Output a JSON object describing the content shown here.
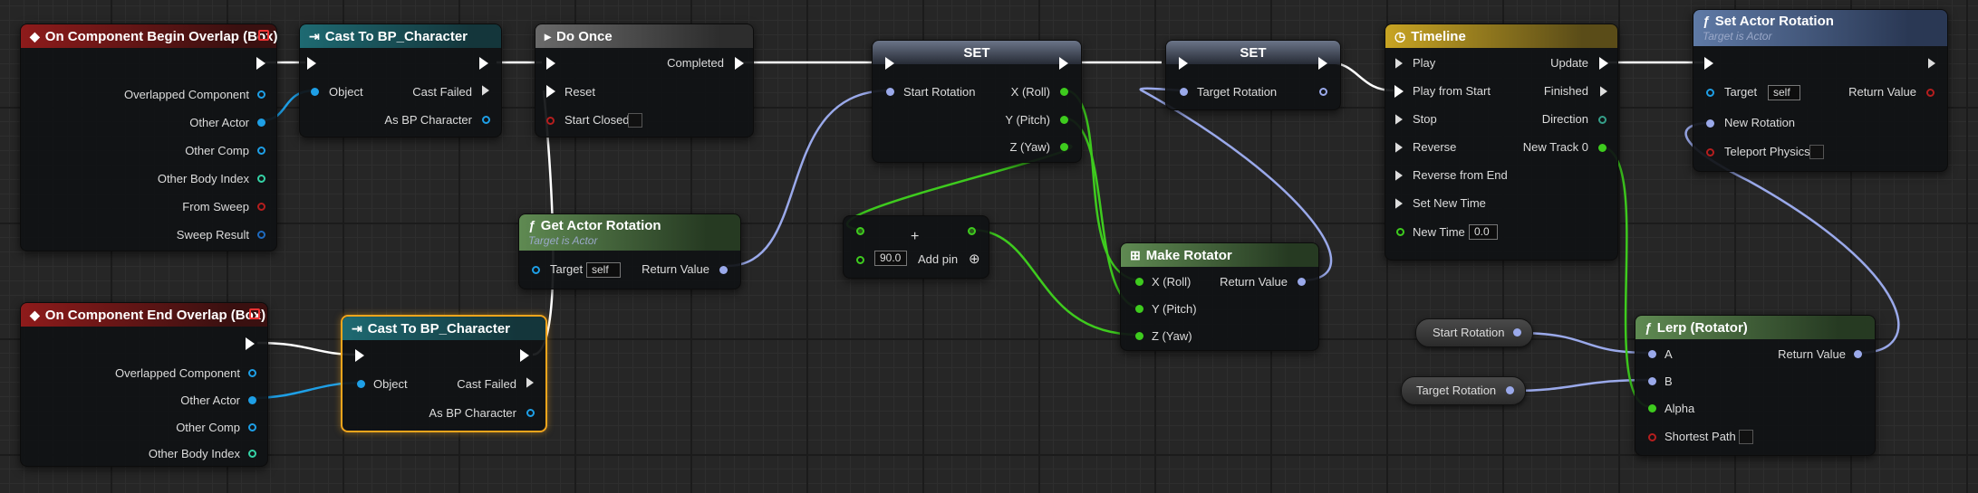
{
  "colors": {
    "exec": "#ffffff",
    "object": "#1e9fe6",
    "struct_rotator": "#9aa9ea",
    "float": "#3ecb1e",
    "bool": "#b51e1e",
    "int": "#35d3a6",
    "structure": "#1e6abf"
  },
  "nodes": {
    "begin_overlap": {
      "title": "On Component Begin Overlap (Box)",
      "pins": [
        "Overlapped Component",
        "Other Actor",
        "Other Comp",
        "Other Body Index",
        "From Sweep",
        "Sweep Result"
      ]
    },
    "cast1": {
      "title": "Cast To BP_Character",
      "object": "Object",
      "cast_failed": "Cast Failed",
      "as_bp": "As BP Character"
    },
    "do_once": {
      "title": "Do Once",
      "completed": "Completed",
      "reset": "Reset",
      "start_closed": "Start Closed"
    },
    "set1": {
      "title": "SET",
      "start_rotation": "Start Rotation",
      "x": "X (Roll)",
      "y": "Y (Pitch)",
      "z": "Z (Yaw)"
    },
    "set2": {
      "title": "SET",
      "target_rotation": "Target Rotation"
    },
    "timeline": {
      "title": "Timeline",
      "inputs": [
        "Play",
        "Play from Start",
        "Stop",
        "Reverse",
        "Reverse from End",
        "Set New Time",
        "New Time"
      ],
      "new_time_value": "0.0",
      "update": "Update",
      "finished": "Finished",
      "direction": "Direction",
      "new_track": "New Track 0"
    },
    "set_actor_rotation": {
      "title": "Set Actor Rotation",
      "subtitle": "Target is Actor",
      "target": "Target",
      "target_value": "self",
      "new_rotation": "New Rotation",
      "teleport": "Teleport Physics",
      "return_value": "Return Value"
    },
    "get_actor_rotation": {
      "title": "Get Actor Rotation",
      "subtitle": "Target is Actor",
      "target": "Target",
      "target_value": "self",
      "return_value": "Return Value"
    },
    "add": {
      "symbol": "+",
      "value": "90.0",
      "add_pin": "Add pin"
    },
    "make_rotator": {
      "title": "Make Rotator",
      "x": "X (Roll)",
      "y": "Y (Pitch)",
      "z": "Z (Yaw)",
      "return_value": "Return Value"
    },
    "end_overlap": {
      "title": "On Component End Overlap (Box)",
      "pins": [
        "Overlapped Component",
        "Other Actor",
        "Other Comp",
        "Other Body Index"
      ]
    },
    "cast2": {
      "title": "Cast To BP_Character",
      "object": "Object",
      "cast_failed": "Cast Failed",
      "as_bp": "As BP Character"
    },
    "var_start": {
      "label": "Start Rotation"
    },
    "var_target": {
      "label": "Target Rotation"
    },
    "lerp": {
      "title": "Lerp (Rotator)",
      "a": "A",
      "b": "B",
      "alpha": "Alpha",
      "shortest": "Shortest Path",
      "return_value": "Return Value"
    }
  }
}
